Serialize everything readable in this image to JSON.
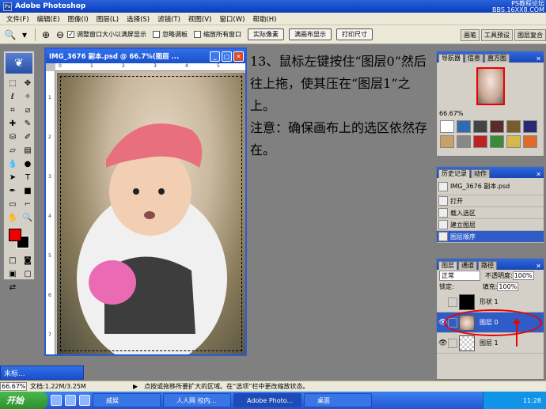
{
  "window": {
    "title": "Adobe Photoshop",
    "watermark": "PS教程论坛",
    "watermark_url": "BBS.16XX8.COM"
  },
  "menu": [
    "文件(F)",
    "编辑(E)",
    "图像(I)",
    "图层(L)",
    "选择(S)",
    "滤镜(T)",
    "视图(V)",
    "窗口(W)",
    "帮助(H)"
  ],
  "options": {
    "zoom_icon": "magnifier-icon",
    "check_resize": "调整窗口大小以满屏显示",
    "check_ignore": "忽略调板",
    "check_zoom_all": "缩放所有窗口",
    "btn_actual": "实际像素",
    "btn_fit": "满画布显示",
    "btn_print": "打印尺寸",
    "well_tabs": [
      "画笔",
      "工具预设",
      "图层复合"
    ]
  },
  "document": {
    "title": "IMG_3676 副本.psd @ 66.7%(图层 ...",
    "ruler_h": [
      "0",
      "1",
      "2",
      "3",
      "4",
      "5"
    ],
    "ruler_v": [
      "1",
      "2",
      "3",
      "4",
      "5",
      "6",
      "7"
    ]
  },
  "instruction": {
    "line1": "13、鼠标左键按住“图层0”然后往上拖，使其压在“图层1”之上。",
    "line2": "注意：确保画布上的选区依然存在。"
  },
  "navigator": {
    "tabs": [
      "导航器",
      "信息",
      "直方图"
    ],
    "zoom": "66.67%"
  },
  "history": {
    "tabs": [
      "历史记录",
      "动作"
    ],
    "snapshot": "IMG_3676 副本.psd",
    "items": [
      "打开",
      "载入选区",
      "建立图层",
      "图层顺序"
    ]
  },
  "layers": {
    "tabs": [
      "图层",
      "通道",
      "路径"
    ],
    "blend_mode": "正常",
    "opacity_label": "不透明度:",
    "opacity": "100%",
    "lock_label": "锁定:",
    "fill_label": "填充:",
    "fill": "100%",
    "rows": [
      "形状 1",
      "图层 0",
      "图层 1"
    ]
  },
  "minimized_doc": "未标...",
  "status": {
    "zoom": "66.67%",
    "doc": "文档:1.22M/3.25M",
    "hint": "点按或拖移所要扩大的区域。在“选项”栏中更改缩放状态。"
  },
  "taskbar": {
    "start": "开始",
    "tasks": [
      "威娱",
      "人人网 校内...",
      "Adobe Photo...",
      "桌面"
    ],
    "time": "11:28"
  },
  "colors": {
    "accent": "#2a5cd6",
    "highlight": "#e00000"
  }
}
